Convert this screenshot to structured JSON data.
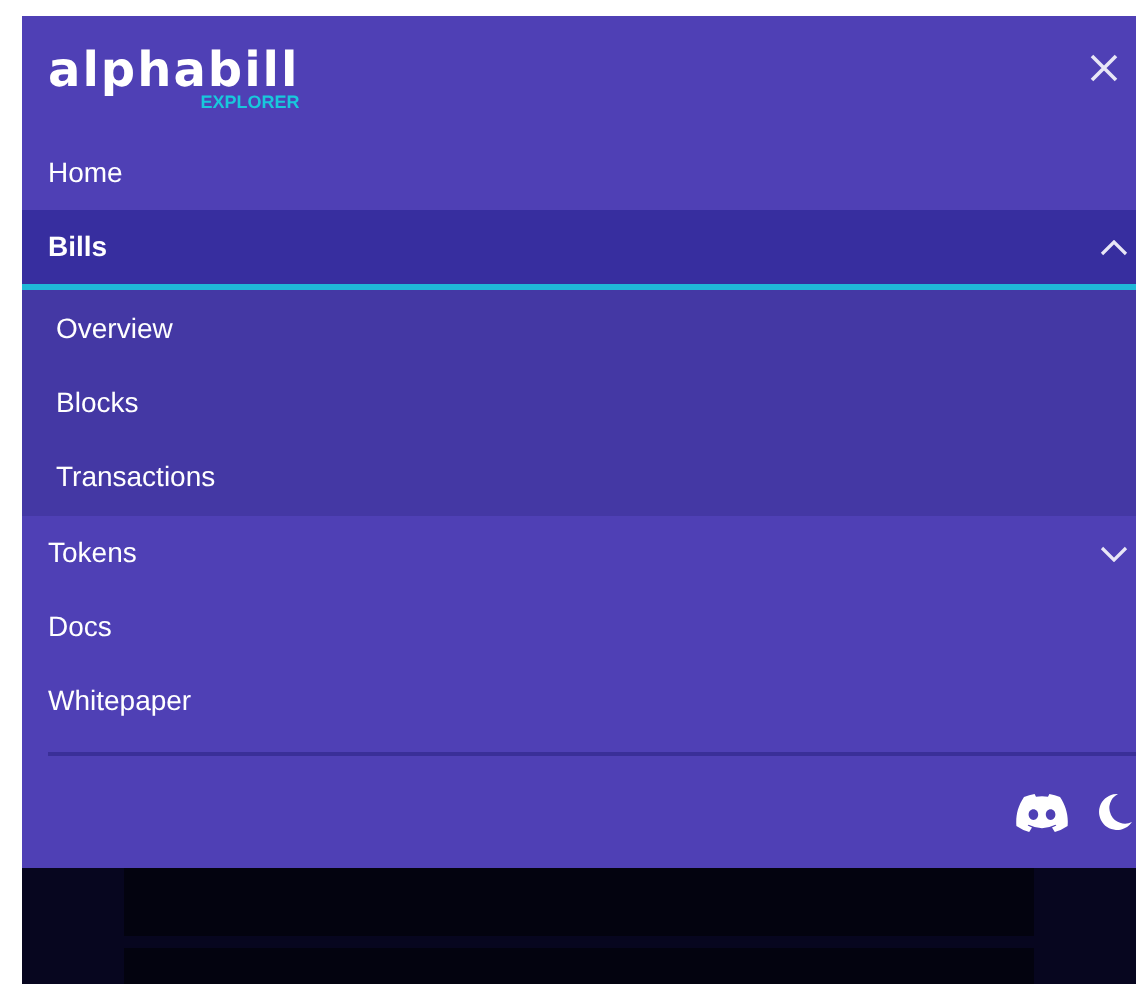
{
  "logo": {
    "wordmark": "alphabill",
    "subtitle": "EXPLORER"
  },
  "menu": [
    {
      "label": "Home",
      "kind": "link",
      "selected": false
    },
    {
      "label": "Bills",
      "kind": "group",
      "selected": true,
      "expanded": true,
      "children": [
        {
          "label": "Overview"
        },
        {
          "label": "Blocks"
        },
        {
          "label": "Transactions"
        }
      ]
    },
    {
      "label": "Tokens",
      "kind": "group",
      "selected": false,
      "expanded": false
    },
    {
      "label": "Docs",
      "kind": "link",
      "selected": false
    },
    {
      "label": "Whitepaper",
      "kind": "link",
      "selected": false
    }
  ]
}
